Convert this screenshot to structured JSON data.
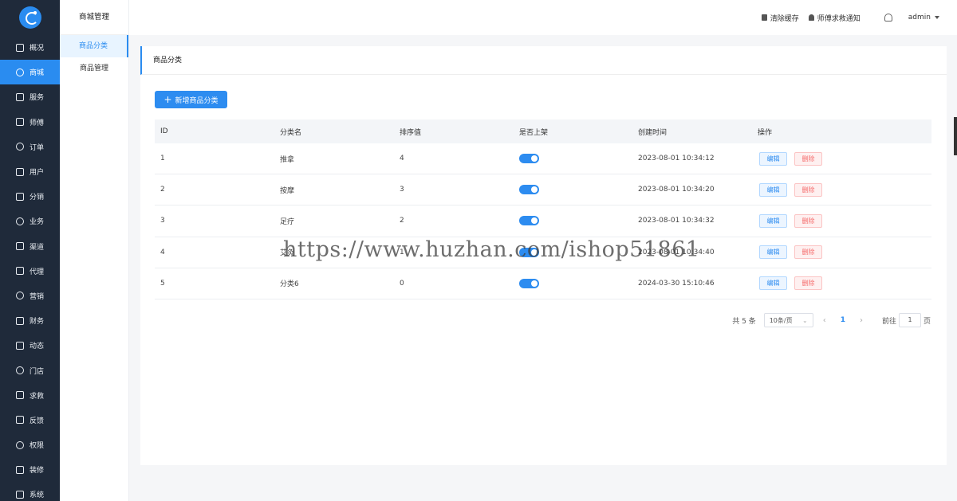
{
  "nav": {
    "items": [
      {
        "label": "概况",
        "active": false
      },
      {
        "label": "商城",
        "active": true
      },
      {
        "label": "服务",
        "active": false
      },
      {
        "label": "师傅",
        "active": false
      },
      {
        "label": "订单",
        "active": false
      },
      {
        "label": "用户",
        "active": false
      },
      {
        "label": "分销",
        "active": false
      },
      {
        "label": "业务",
        "active": false
      },
      {
        "label": "渠道",
        "active": false
      },
      {
        "label": "代理",
        "active": false
      },
      {
        "label": "营销",
        "active": false
      },
      {
        "label": "财务",
        "active": false
      },
      {
        "label": "动态",
        "active": false
      },
      {
        "label": "门店",
        "active": false
      },
      {
        "label": "求救",
        "active": false
      },
      {
        "label": "反馈",
        "active": false
      },
      {
        "label": "权限",
        "active": false
      },
      {
        "label": "装修",
        "active": false
      },
      {
        "label": "系统",
        "active": false
      }
    ]
  },
  "submenu": {
    "title": "商城管理",
    "items": [
      {
        "label": "商品分类",
        "active": true
      },
      {
        "label": "商品管理",
        "active": false
      }
    ]
  },
  "header": {
    "clear_cache": "清除缓存",
    "rescue_notice": "师傅求救通知",
    "user": "admin"
  },
  "card": {
    "title": "商品分类",
    "add_button": "新增商品分类"
  },
  "table": {
    "columns": [
      "ID",
      "分类名",
      "排序值",
      "是否上架",
      "创建时间",
      "操作"
    ],
    "rows": [
      {
        "id": "1",
        "name": "推拿",
        "sort": "4",
        "on_shelf": true,
        "created": "2023-08-01 10:34:12"
      },
      {
        "id": "2",
        "name": "按摩",
        "sort": "3",
        "on_shelf": true,
        "created": "2023-08-01 10:34:20"
      },
      {
        "id": "3",
        "name": "足疗",
        "sort": "2",
        "on_shelf": true,
        "created": "2023-08-01 10:34:32"
      },
      {
        "id": "4",
        "name": "艾灸",
        "sort": "1",
        "on_shelf": true,
        "created": "2023-08-01 10:34:40"
      },
      {
        "id": "5",
        "name": "分类6",
        "sort": "0",
        "on_shelf": true,
        "created": "2024-03-30 15:10:46"
      }
    ],
    "edit_label": "编辑",
    "delete_label": "删除"
  },
  "pager": {
    "total": "共 5 条",
    "page_size": "10条/页",
    "current": "1",
    "goto_label": "前往",
    "goto_value": "1",
    "page_unit": "页"
  },
  "watermark": "https://www.huzhan.com/ishop51861",
  "colors": {
    "primary": "#2d8cf0",
    "nav_bg": "#1f2a3a",
    "danger": "#f56c6c"
  }
}
